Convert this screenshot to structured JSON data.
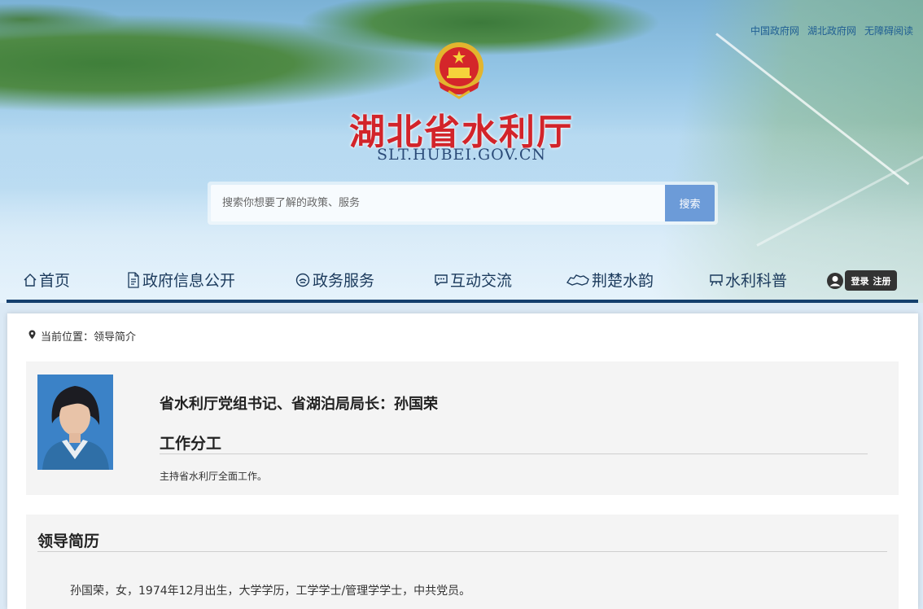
{
  "header": {
    "top_links": [
      "中国政府网",
      "湖北政府网",
      "无障碍阅读"
    ],
    "site_title": "湖北省水利厅",
    "site_domain": "SLT.HUBEI.GOV.CN",
    "emblem_icon": "national-emblem-icon"
  },
  "search": {
    "placeholder": "搜索你想要了解的政策、服务",
    "value": "",
    "button_label": "搜索"
  },
  "nav": {
    "items": [
      {
        "label": "首页",
        "icon": "home-icon"
      },
      {
        "label": "政府信息公开",
        "icon": "document-icon"
      },
      {
        "label": "政务服务",
        "icon": "service-icon"
      },
      {
        "label": "互动交流",
        "icon": "chat-icon"
      },
      {
        "label": "荆楚水韵",
        "icon": "map-icon"
      },
      {
        "label": "水利科普",
        "icon": "board-icon"
      }
    ],
    "login_label": "登录",
    "register_label": "注册"
  },
  "breadcrumb": {
    "text": "当前位置：领导简介"
  },
  "profile": {
    "title": "省水利厅党组书记、省湖泊局局长：孙国荣",
    "duty_heading": "工作分工",
    "duty_text": "主持省水利厅全面工作。"
  },
  "resume": {
    "heading": "领导简历",
    "text": "孙国荣，女，1974年12月出生，大学学历，工学学士/管理学学士，中共党员。"
  },
  "colors": {
    "title_red": "#d2242a",
    "nav_blue": "#15406e",
    "search_button": "#6c9bd8"
  }
}
